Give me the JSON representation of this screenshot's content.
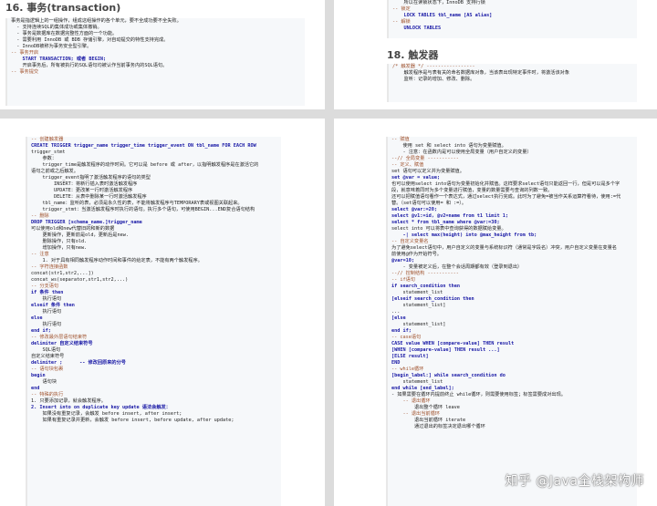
{
  "top_left": {
    "heading": "16. 事务(transaction)",
    "lines": [
      {
        "t": "事务是指逻辑上的一组操作，组成这组操作的各个单元，要不全成功要不全失败。",
        "s": "n"
      },
      {
        "t": "  - 支持连续SQL的集体成功或集体撤销。",
        "s": "n"
      },
      {
        "t": "  - 事务是数据库在数据完整性方面的一个功能。",
        "s": "n"
      },
      {
        "t": "  - 需要利用 InnoDB 或 BDB 存储引擎，对自动提交的特性支持完成。",
        "s": "n"
      },
      {
        "t": "  - InnoDB被称为事务安全型引擎。",
        "s": "n"
      },
      {
        "t": "-- 事务开启",
        "s": "c"
      },
      {
        "t": "    START TRANSACTION; 或者 BEGIN;",
        "s": "k"
      },
      {
        "t": "    开启事务后，所有被执行的SQL语句均被认作当前事务内的SQL语句。",
        "s": "n"
      },
      {
        "t": "-- 事务提交",
        "s": "c"
      }
    ]
  },
  "top_right": {
    "top_lines": [
      {
        "t": "    所以在读锁状态下，InnoDB 支持行锁",
        "s": "n"
      },
      {
        "t": "-- 锁定",
        "s": "c"
      },
      {
        "t": "    LOCK TABLES tbl_name [AS alias]",
        "s": "k"
      },
      {
        "t": "-- 解锁",
        "s": "c"
      },
      {
        "t": "    UNLOCK TABLES",
        "s": "k"
      }
    ],
    "heading": "18. 触发器",
    "lines": [
      {
        "t": "/* 触发器 */ -----------------",
        "s": "c"
      },
      {
        "t": "    触发程序是与表有关的命名数据库对象，当该表出现特定事件时，将激活该对象",
        "s": "n"
      },
      {
        "t": "    监听：记录的增加、修改、删除。",
        "s": "n"
      }
    ]
  },
  "bottom_left": {
    "lines": [
      {
        "t": "-- 创建触发器",
        "s": "c"
      },
      {
        "t": "CREATE TRIGGER trigger_name trigger_time trigger_event ON tbl_name FOR EACH ROW",
        "s": "k"
      },
      {
        "t": "trigger_stmt",
        "s": "n"
      },
      {
        "t": "    参数：",
        "s": "n"
      },
      {
        "t": "    trigger_time是触发程序的动作时间。它可以是 before 或 after，以指明触发程序是在激活它的",
        "s": "n"
      },
      {
        "t": "语句之前或之后触发。",
        "s": "n"
      },
      {
        "t": "    trigger_event指明了激活触发程序的语句的类型",
        "s": "n"
      },
      {
        "t": "        INSERT：将新行插入表时激活触发程序",
        "s": "n"
      },
      {
        "t": "        UPDATE：更改某一行时激活触发程序",
        "s": "n"
      },
      {
        "t": "        DELETE：从表中删除某一行时激活触发程序",
        "s": "n"
      },
      {
        "t": "    tbl_name：监听的表，必须是永久性的表，不能将触发程序与TEMPORARY表或视图关联起来。",
        "s": "n"
      },
      {
        "t": "    trigger_stmt：当激活触发程序时执行的语句。执行多个语句，可使用BEGIN...END复合语句结构",
        "s": "n"
      },
      {
        "t": "-- 删除",
        "s": "c"
      },
      {
        "t": "DROP TRIGGER [schema_name.]trigger_name",
        "s": "k"
      },
      {
        "t": "可以使用old和new代替旧的和新的数据",
        "s": "n"
      },
      {
        "t": "    更新操作，更新前是old，更新后是new.",
        "s": "n"
      },
      {
        "t": "    删除操作，只有old.",
        "s": "n"
      },
      {
        "t": "    增加操作，只有new.",
        "s": "n"
      },
      {
        "t": "-- 注意",
        "s": "c"
      },
      {
        "t": "    1. 对于具有相同触发程序动作时间和事件的给定表，不能有两个触发程序。",
        "s": "n"
      },
      {
        "t": "-- 字符连接函数",
        "s": "c"
      },
      {
        "t": "concat(str1,str2,...])",
        "s": "n"
      },
      {
        "t": "concat_ws(separator,str1,str2,...)",
        "s": "n"
      },
      {
        "t": "-- 分支语句",
        "s": "c"
      },
      {
        "t": "if 条件 then",
        "s": "k"
      },
      {
        "t": "    执行语句",
        "s": "n"
      },
      {
        "t": "elseif 条件 then",
        "s": "k"
      },
      {
        "t": "    执行语句",
        "s": "n"
      },
      {
        "t": "else",
        "s": "k"
      },
      {
        "t": "    执行语句",
        "s": "n"
      },
      {
        "t": "end if;",
        "s": "k"
      },
      {
        "t": "-- 修改最外层语句结束符",
        "s": "c"
      },
      {
        "t": "delimiter 自定义结束符号",
        "s": "k"
      },
      {
        "t": "    SQL语句",
        "s": "n"
      },
      {
        "t": "自定义结束符号",
        "s": "n"
      },
      {
        "t": "delimiter ;      -- 修改回原来的分号",
        "s": "k"
      },
      {
        "t": "-- 语句块包裹",
        "s": "c"
      },
      {
        "t": "begin",
        "s": "k"
      },
      {
        "t": "    语句块",
        "s": "n"
      },
      {
        "t": "end",
        "s": "k"
      },
      {
        "t": "-- 特殊的执行",
        "s": "c"
      },
      {
        "t": "1. 只要添加记录，就会触发程序。",
        "s": "n"
      },
      {
        "t": "2. Insert into on duplicate key update 语法会触发：",
        "s": "k"
      },
      {
        "t": "    如果没有重复记录，会触发 before insert, after insert;",
        "s": "n"
      },
      {
        "t": "    如果有重复记录并更新，会触发 before insert, before update, after update;",
        "s": "n"
      }
    ]
  },
  "bottom_right": {
    "lines": [
      {
        "t": "-- 赋值",
        "s": "c"
      },
      {
        "t": "    使用 set 和 select into 语句为变量赋值。",
        "s": "n"
      },
      {
        "t": "    - 注意：在函数内是可以使用全局变量（用户自定义的变量）",
        "s": "n"
      },
      {
        "t": "--// 全局变量 -----------",
        "s": "c"
      },
      {
        "t": "-- 定义、赋值",
        "s": "c"
      },
      {
        "t": "set 语句可以定义并为变量赋值。",
        "s": "n"
      },
      {
        "t": "set @var = value;",
        "s": "k"
      },
      {
        "t": "也可以使用select into语句为变量初始化并赋值。这样要求select语句只能返回一行，但是可以是多个字",
        "s": "n"
      },
      {
        "t": "段，就意味着同时为多个变量进行赋值，变量的数量需要与查询的列数一致。",
        "s": "n"
      },
      {
        "t": "还可以把赋值语句看作一个表达式，通过select执行完成。此时为了避免=被当作关系运算符看待，使用:=代",
        "s": "n"
      },
      {
        "t": "替。（set语句可以使用= 和 :=）。",
        "s": "n"
      },
      {
        "t": "select @var:=20;",
        "s": "k"
      },
      {
        "t": "select @v1:=id, @v2=name from t1 limit 1;",
        "s": "k"
      },
      {
        "t": "select * from tbl_name where @var:=30;",
        "s": "k"
      },
      {
        "t": "select into 可以将表中查询获得的数据赋给变量。",
        "s": "n"
      },
      {
        "t": "    -| select max(height) into @max_height from tb;",
        "s": "k"
      },
      {
        "t": "-- 自定义变量名",
        "s": "c"
      },
      {
        "t": "为了避免select语句中，用户自定义的变量与系统标识符（通常是字段名）冲突，用户自定义变量在变量名",
        "s": "n"
      },
      {
        "t": "前使用@作为开始符号。",
        "s": "n"
      },
      {
        "t": "@var=10;",
        "s": "k"
      },
      {
        "t": "    - 变量被定义后，在整个会话周期都有效（登录到退出）",
        "s": "n"
      },
      {
        "t": "--// 控制结构 -----------",
        "s": "c"
      },
      {
        "t": "-- if语句",
        "s": "c"
      },
      {
        "t": "if search_condition then",
        "s": "k"
      },
      {
        "t": "    statement_list",
        "s": "n"
      },
      {
        "t": "[elseif search_condition then",
        "s": "k"
      },
      {
        "t": "    statement_list]",
        "s": "n"
      },
      {
        "t": "...",
        "s": "n"
      },
      {
        "t": "[else",
        "s": "k"
      },
      {
        "t": "    statement_list]",
        "s": "n"
      },
      {
        "t": "end if;",
        "s": "k"
      },
      {
        "t": "-- case语句",
        "s": "c"
      },
      {
        "t": "CASE value WHEN [compare-value] THEN result",
        "s": "k"
      },
      {
        "t": "[WHEN [compare-value] THEN result ...]",
        "s": "k"
      },
      {
        "t": "[ELSE result]",
        "s": "k"
      },
      {
        "t": "END",
        "s": "k"
      },
      {
        "t": "-- while循环",
        "s": "c"
      },
      {
        "t": "[begin_label:] while search_condition do",
        "s": "k"
      },
      {
        "t": "    statement_list",
        "s": "n"
      },
      {
        "t": "end while [end_label];",
        "s": "k"
      },
      {
        "t": "- 如果需要在循环内提前终止 while循环，则需要使用标签；标签需要成对出现。",
        "s": "n"
      },
      {
        "t": "    -- 退出循环",
        "s": "c"
      },
      {
        "t": "        退出整个循环 leave",
        "s": "n"
      },
      {
        "t": "    -- 退出当前循环",
        "s": "c"
      },
      {
        "t": "        退出当前循环 iterate",
        "s": "n"
      },
      {
        "t": "        通过退出的标签决定退出哪个循环",
        "s": "n"
      }
    ]
  },
  "watermark": "知乎 @Java全栈架构师"
}
